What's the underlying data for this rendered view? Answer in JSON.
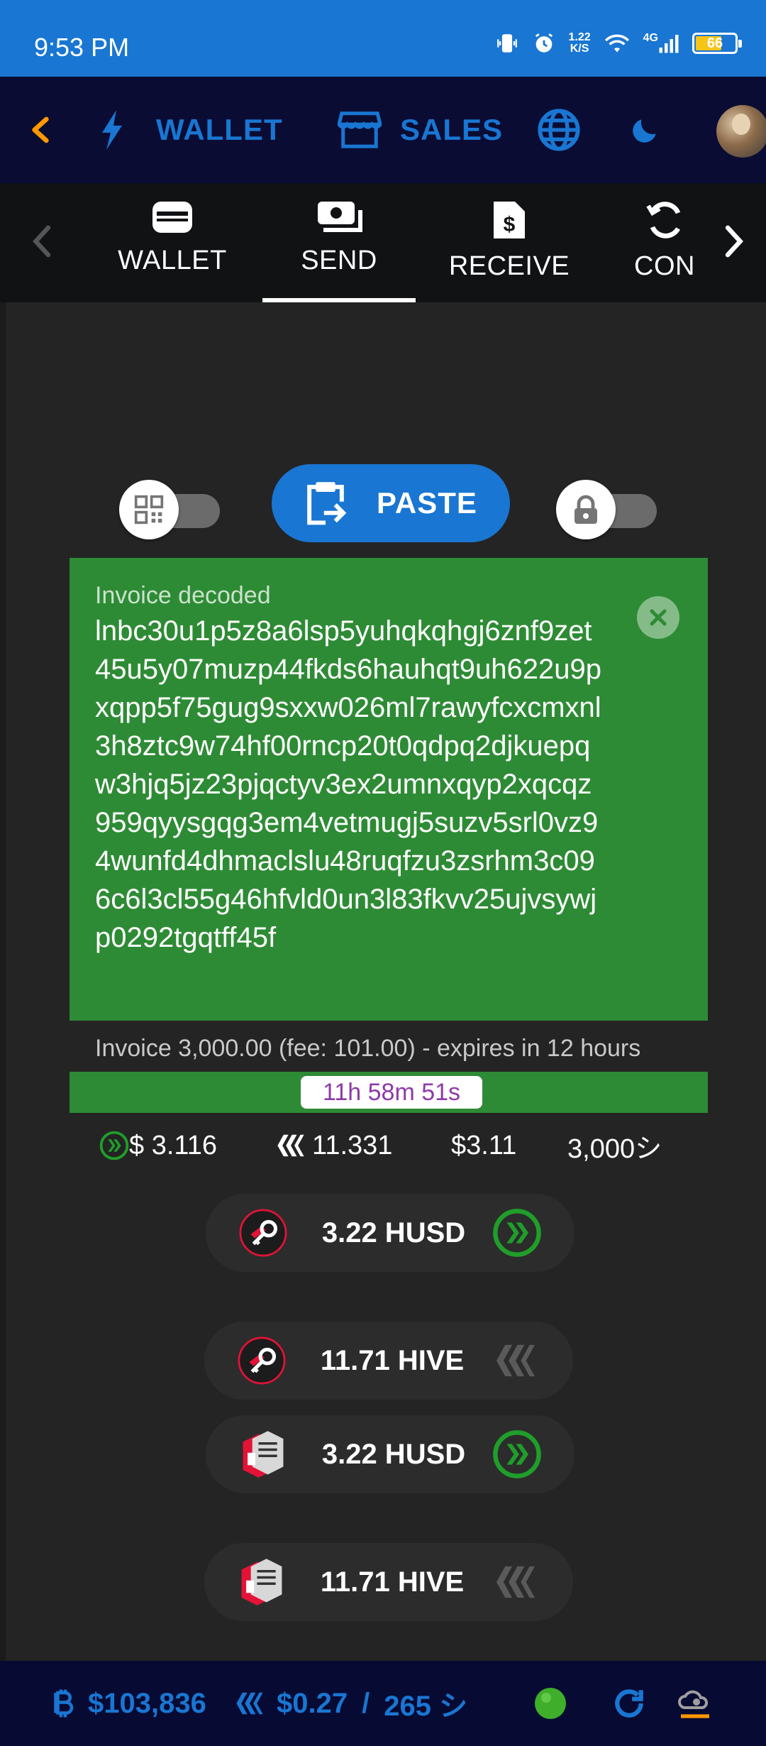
{
  "status_bar": {
    "time": "9:53 PM",
    "net_speed_value": "1.22",
    "net_speed_unit": "K/S",
    "network": "4G",
    "battery": "66"
  },
  "top_nav": {
    "wallet_label": "WALLET",
    "sales_label": "SALES"
  },
  "tabs": [
    {
      "label": "WALLET",
      "icon": "wallet-icon"
    },
    {
      "label": "SEND",
      "icon": "send-money-icon",
      "active": true
    },
    {
      "label": "RECEIVE",
      "icon": "receive-invoice-icon"
    },
    {
      "label": "CON",
      "icon": "convert-icon"
    }
  ],
  "controls": {
    "paste_label": "PASTE",
    "qr_toggle_on": false,
    "lock_toggle_on": false
  },
  "invoice": {
    "title": "Invoice decoded",
    "text": "lnbc30u1p5z8a6lsp5yuhqkqhgj6znf9zet45u5y07muzp44fkds6hauhqt9uh622u9pxqpp5f75gug9sxxw026ml7rawyfcxcmxnl3h8ztc9w74hf00rncp20t0qdpq2djkuepqw3hjq5jz23pjqctyv3ex2umnxqyp2xqcqz959qyysgqg3em4vetmugj5suzv5srl0vz94wunfd4dhmaclslu48ruqfzu3zsrhm3c096c6l3cl55g46hfvld0un3l83fkvv25ujvsywjp0292tgqtff45f",
    "summary": "Invoice 3,000.00 (fee: 101.00) - expires in 12 hours",
    "timer": "11h 58m 51s"
  },
  "rates": {
    "hbd": "$ 3.116",
    "hive": "11.331",
    "usd": "$3.11",
    "sats": "3,000シ"
  },
  "payment_options": [
    {
      "method": "keychain",
      "amount": "3.22 HUSD",
      "currency": "HBD"
    },
    {
      "method": "keychain",
      "amount": "11.71 HIVE",
      "currency": "HIVE"
    },
    {
      "method": "hivesigner",
      "amount": "3.22 HUSD",
      "currency": "HBD"
    },
    {
      "method": "hivesigner",
      "amount": "11.71 HIVE",
      "currency": "HIVE"
    }
  ],
  "bottom_bar": {
    "btc_price": "$103,836",
    "hive_price": "$0.27",
    "separator": "/",
    "sats_rate": "265 シ"
  },
  "colors": {
    "brand_blue": "#1976d2",
    "nav_bg": "#0a0c33",
    "invoice_green": "#2e8b35",
    "timer_text": "#8e3aa8",
    "hbd_green": "#1f9e2a",
    "keychain_red": "#e31337"
  }
}
